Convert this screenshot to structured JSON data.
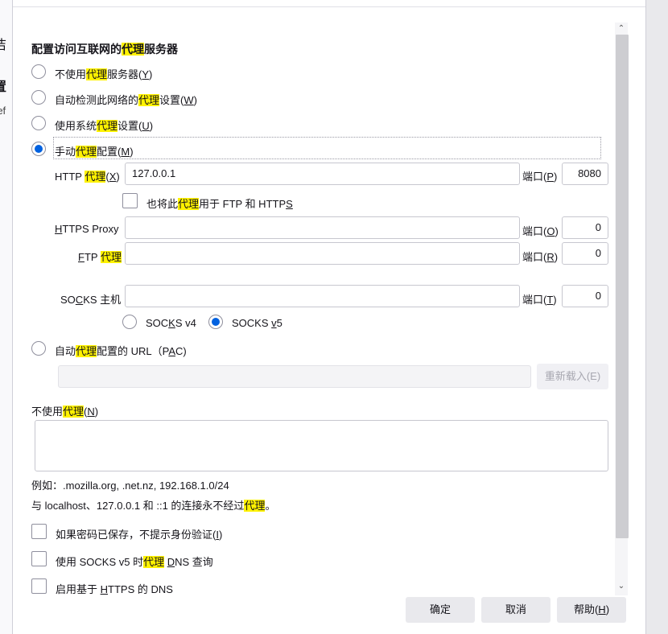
{
  "background": {
    "line1": "洁",
    "line2": "置",
    "line3": "ref"
  },
  "section_title": {
    "pre": "配置访问互联网的",
    "hl": "代理",
    "post": "服务器"
  },
  "options": {
    "no_proxy": {
      "pre": "不使用",
      "hl": "代理",
      "post": "服务器(",
      "key": "Y",
      "end": ")",
      "selected": false
    },
    "auto_detect": {
      "pre": "自动检测此网络的",
      "hl": "代理",
      "post": "设置(",
      "key": "W",
      "end": ")",
      "selected": false
    },
    "system": {
      "pre": "使用系统",
      "hl": "代理",
      "post": "设置(",
      "key": "U",
      "end": ")",
      "selected": false
    },
    "manual": {
      "pre": "手动",
      "hl": "代理",
      "post": "配置(",
      "key": "M",
      "end": ")",
      "selected": true
    },
    "pac": {
      "pre": "自动",
      "hl": "代理",
      "post": "配置的 URL（P",
      "key": "A",
      "end": "C)",
      "selected": false
    }
  },
  "http": {
    "label_pre": "HTTP ",
    "label_hl": "代理",
    "label_open": "(",
    "label_key": "X",
    "label_close": ")",
    "host": "127.0.0.1",
    "port_label_pre": "端口(",
    "port_key": "P",
    "port_label_end": ")",
    "port": "8080"
  },
  "also_use": {
    "pre": "也将此",
    "hl": "代理",
    "post": "用于 FTP 和 HTTP",
    "key": "S",
    "checked": false
  },
  "https": {
    "label_key": "H",
    "label_rest": "TTPS Proxy",
    "host": "",
    "port_label_pre": "端口(",
    "port_key": "O",
    "port_label_end": ")",
    "port": "0"
  },
  "ftp": {
    "label_key": "F",
    "label_rest": "TP ",
    "label_hl": "代理",
    "host": "",
    "port_label_pre": "端口(",
    "port_key": "R",
    "port_label_end": ")",
    "port": "0"
  },
  "socks": {
    "label_pre": "SO",
    "label_key": "C",
    "label_post": "KS 主机",
    "host": "",
    "port_label_pre": "端口(",
    "port_key": "T",
    "port_label_end": ")",
    "port": "0",
    "v4": {
      "pre": "SOC",
      "key": "K",
      "post": "S v4",
      "selected": false
    },
    "v5": {
      "pre": "SOCKS ",
      "key": "v",
      "post": "5",
      "selected": true
    }
  },
  "pac_url": "",
  "reload_button": "重新载入(E)",
  "no_proxy_for": {
    "pre": "不使用",
    "hl": "代理",
    "open": "(",
    "key": "N",
    "close": ")",
    "value": ""
  },
  "example": "例如：.mozilla.org, .net.nz, 192.168.1.0/24",
  "localhost_note": {
    "pre": "与 localhost、127.0.0.1 和 ::1 的连接永不经过",
    "hl": "代理",
    "post": "。"
  },
  "checkboxes": {
    "no_auth_prompt": {
      "pre": "如果密码已保存，不提示身份验证(",
      "key": "I",
      "end": ")",
      "checked": false
    },
    "socks_dns": {
      "pre": "使用 SOCKS v5 时",
      "hl": "代理",
      "mid": " ",
      "key": "D",
      "post": "NS 查询",
      "checked": false
    },
    "https_dns": {
      "pre": "启用基于 ",
      "key": "H",
      "post": "TTPS 的 DNS",
      "checked": false
    }
  },
  "buttons": {
    "ok": "确定",
    "cancel": "取消",
    "help_pre": "帮助(",
    "help_key": "H",
    "help_end": ")"
  },
  "scroll_arrows": {
    "up": "⌃",
    "down": "⌄"
  }
}
